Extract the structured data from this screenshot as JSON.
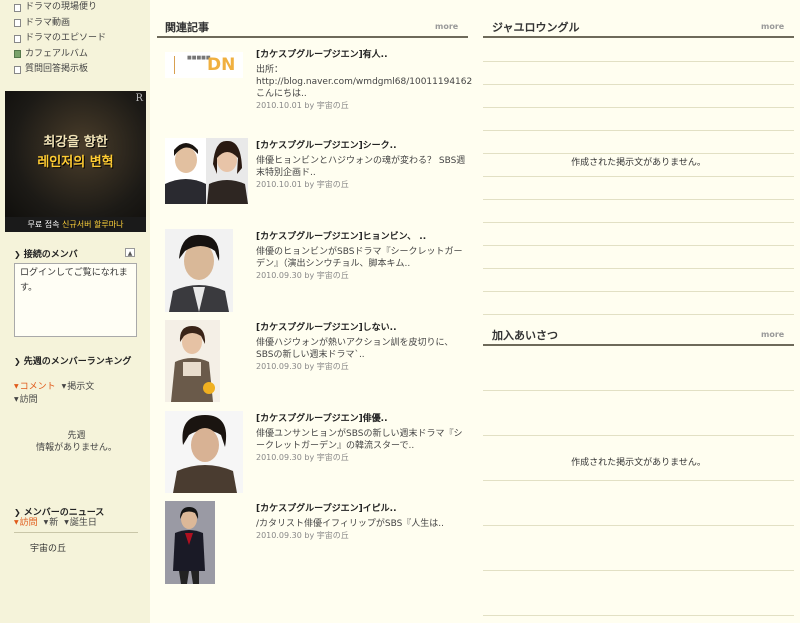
{
  "sidebar": {
    "menu": [
      {
        "label": "ドラマの現場便り",
        "icon": "board-icon"
      },
      {
        "label": "ドラマ動画",
        "icon": "board-icon"
      },
      {
        "label": "ドラマのエピソード",
        "icon": "board-icon"
      },
      {
        "label": "カフェアルバム",
        "icon": "photo-album-icon"
      },
      {
        "label": "質問回答掲示板",
        "icon": "board-icon"
      }
    ],
    "banner": {
      "line1": "최강을 향한",
      "line2": "레인저의 변혁",
      "foot_white": "무료 접속",
      "foot_yellow": "신규서버 할루마나",
      "corner": "R"
    },
    "connected": {
      "title": "接続のメンバ",
      "collapse": "▲",
      "message": "ログインしてご覧になれます。"
    },
    "ranking": {
      "title": "先週のメンバーランキング",
      "tabs": [
        "コメント",
        "掲示文",
        "訪問"
      ],
      "empty_line1": "先週",
      "empty_line2": "情報がありません。"
    },
    "news": {
      "title": "メンバーのニュース",
      "tabs": [
        "訪問",
        "新",
        "誕生日"
      ],
      "member": "宇宙の丘"
    }
  },
  "articles_panel": {
    "title": "関連記事",
    "more": "more",
    "items": [
      {
        "title": "[カケスプグループジエン]有人..",
        "excerpt": "出所：http://blog.naver.com/wmdgml68/10011194162 こんにちは..",
        "date": "2010.10.01",
        "by": "by",
        "author": "宇宙の丘",
        "logo": "DN"
      },
      {
        "title": "[カケスプグループジエン]シーク..",
        "excerpt": "俳優ヒョンビンとハジウォンの魂が変わる？ SBS週末特別企画ド..",
        "date": "2010.10.01",
        "by": "by",
        "author": "宇宙の丘"
      },
      {
        "title": "[カケスプグループジエン]ヒョンビン、 ..",
        "excerpt": "俳優のヒョンビンがSBSドラマ『シークレットガーデン』（演出シンウチョル、脚本キム..",
        "date": "2010.09.30",
        "by": "by",
        "author": "宇宙の丘"
      },
      {
        "title": "[カケスプグループジエン]しない..",
        "excerpt": "俳優ハジウォンが熱いアクション訓を皮切りに、 SBSの新しい週末ドラマ`..",
        "date": "2010.09.30",
        "by": "by",
        "author": "宇宙の丘"
      },
      {
        "title": "[カケスプグループジエン]俳優..",
        "excerpt": "俳優ユンサンヒョンがSBSの新しい週末ドラマ『シークレットガーデン』の韓流スターで..",
        "date": "2010.09.30",
        "by": "by",
        "author": "宇宙の丘"
      },
      {
        "title": "[カケスプグループジエン]イピル..",
        "excerpt": "/カタリスト俳優イフィリップがSBS『人生は..",
        "date": "2010.09.30",
        "by": "by",
        "author": "宇宙の丘"
      }
    ]
  },
  "right_panel_1": {
    "title": "ジャユロウングル",
    "more": "more",
    "empty": "作成された掲示文がありません。"
  },
  "right_panel_2": {
    "title": "加入あいさつ",
    "more": "more",
    "empty": "作成された掲示文がありません。"
  },
  "colors": {
    "accent": "#e05a1a",
    "rule": "#6e6a5a",
    "background": "#fffef0",
    "sidebar": "#f5f3da"
  }
}
